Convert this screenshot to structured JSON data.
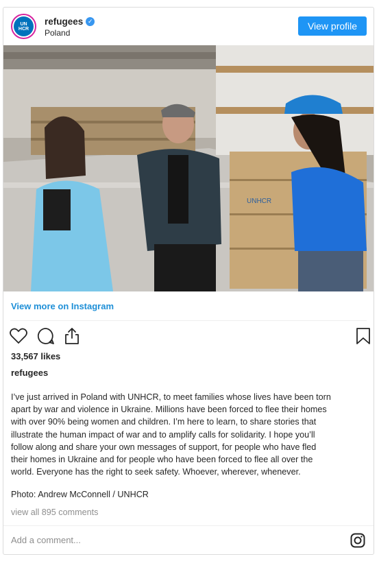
{
  "header": {
    "username": "refugees",
    "verified_mark": "✓",
    "location": "Poland",
    "avatar_text_top": "UN",
    "avatar_text_bottom": "HCR",
    "view_profile_label": "View profile"
  },
  "photo": {
    "description_icon": "photo-of-three-people-in-warehouse",
    "box_label": "UNHCR"
  },
  "view_more_label": "View more on Instagram",
  "actions": {
    "icons": [
      "heart-icon",
      "comment-icon",
      "share-icon",
      "bookmark-icon"
    ]
  },
  "likes": "33,567 likes",
  "caption_user": "refugees",
  "caption_lines": [
    "I’ve just arrived in Poland with UNHCR, to meet families whose lives have been torn",
    "apart by war and violence in Ukraine. Millions have been forced to flee their homes",
    "with over 90% being women and children. I’m here to learn, to share stories that",
    "illustrate the human impact of war and to amplify calls for solidarity. I hope you’ll",
    "follow along and share your own messages of support, for people who have fled",
    "their homes in Ukraine and for people who have been forced to flee all over the",
    "world.  Everyone has the right to seek safety. Whoever, wherever, whenever."
  ],
  "photo_credit": "Photo: Andrew McConnell / UNHCR",
  "comments_link": "view all 895 comments",
  "comment_placeholder": "Add a comment...",
  "colors": {
    "accent_blue": "#1e95f5",
    "link_blue": "#1e8fd7",
    "unhcr_blue": "#0072bc"
  }
}
